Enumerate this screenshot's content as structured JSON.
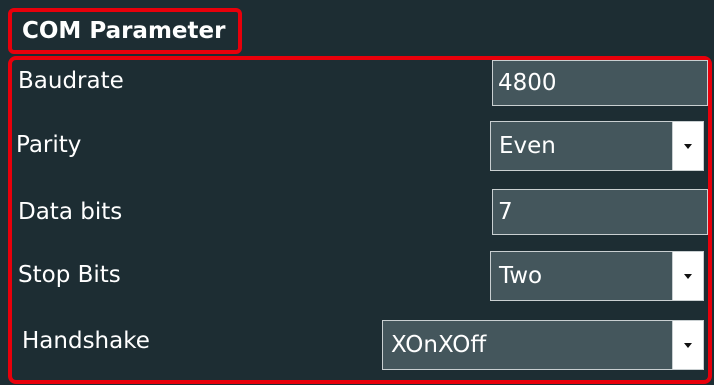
{
  "title": "COM Parameter",
  "colors": {
    "panel_background": "#1d2d33",
    "field_background": "#44565c",
    "highlight_border": "#e8000b"
  },
  "params": {
    "baudrate": {
      "label": "Baudrate",
      "value": "4800"
    },
    "parity": {
      "label": "Parity",
      "value": "Even",
      "icon": "chevron-down-icon"
    },
    "data_bits": {
      "label": "Data bits",
      "value": "7"
    },
    "stop_bits": {
      "label": "Stop Bits",
      "value": "Two",
      "icon": "chevron-down-icon"
    },
    "handshake": {
      "label": "Handshake",
      "value": "XOnXOff",
      "icon": "chevron-down-icon"
    }
  }
}
